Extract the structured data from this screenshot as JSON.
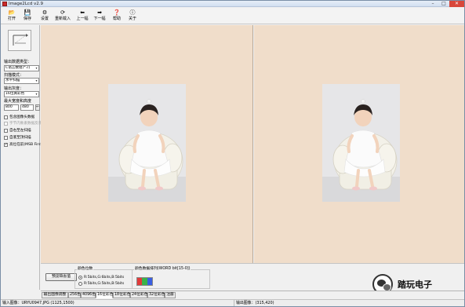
{
  "window": {
    "title": "Image2Lcd v2.9",
    "min": "–",
    "max": "□",
    "close": "✕"
  },
  "toolbar": [
    {
      "label": "打开",
      "icon": "open-folder-icon",
      "glyph": "📂"
    },
    {
      "label": "保存",
      "icon": "save-disk-icon",
      "glyph": "💾"
    },
    {
      "label": "设置",
      "icon": "settings-icon",
      "glyph": "⚙"
    },
    {
      "label": "重新载入",
      "icon": "reload-icon",
      "glyph": "⟳"
    },
    {
      "label": "上一幅",
      "icon": "arrow-left-icon",
      "glyph": "⬅"
    },
    {
      "label": "下一幅",
      "icon": "arrow-right-icon",
      "glyph": "➡"
    },
    {
      "label": "帮助",
      "icon": "help-icon",
      "glyph": "❓"
    },
    {
      "label": "关于",
      "icon": "about-icon",
      "glyph": "ⓘ"
    }
  ],
  "left": {
    "output_type_label": "输出数据类型：",
    "output_type_value": "C语言数组(*.c)",
    "scan_mode_label": "扫描模式：",
    "scan_mode_value": "水平扫描",
    "output_gray_label": "输出灰度：",
    "output_gray_value": "16位真彩色",
    "max_size_label": "最大宽度和高度",
    "max_width": "800",
    "max_height": "480",
    "dim_button": "←",
    "checkboxes": [
      {
        "label": "包含图像头数据",
        "checked": false,
        "enabled": true
      },
      {
        "label": "字节内象素数据反序",
        "checked": false,
        "enabled": false
      },
      {
        "label": "自右至左扫描",
        "checked": false,
        "enabled": true
      },
      {
        "label": "自底至顶扫描",
        "checked": false,
        "enabled": true
      },
      {
        "label": "高位在前(MSB First)",
        "checked": true,
        "enabled": true
      }
    ],
    "check_mark": "✓"
  },
  "bottom": {
    "preview_button": "预览缺省值",
    "color_order_title": "颜色位数",
    "color_order_options": [
      {
        "label": "R:5bits,G:6bits,B:5bits",
        "selected": true
      },
      {
        "label": "R:5bits,G:5bits,B:5bits",
        "selected": false
      }
    ],
    "color_arrange_title": "颜色数据排列(WORD bit[15-0])",
    "swatch_colors": [
      "#e23a3a",
      "#3ab34a",
      "#3a5ee2"
    ]
  },
  "tabs": [
    "输出图像调整",
    "256色",
    "4096色",
    "16位彩色",
    "18位彩色",
    "24位彩色",
    "32位彩色",
    "注册"
  ],
  "active_tab": 3,
  "status": {
    "input": "输入图像：URYU0947.JPG (1125,1500)",
    "output": "输出图像：(315,420)"
  },
  "watermark": {
    "text": "踏玩电子"
  }
}
